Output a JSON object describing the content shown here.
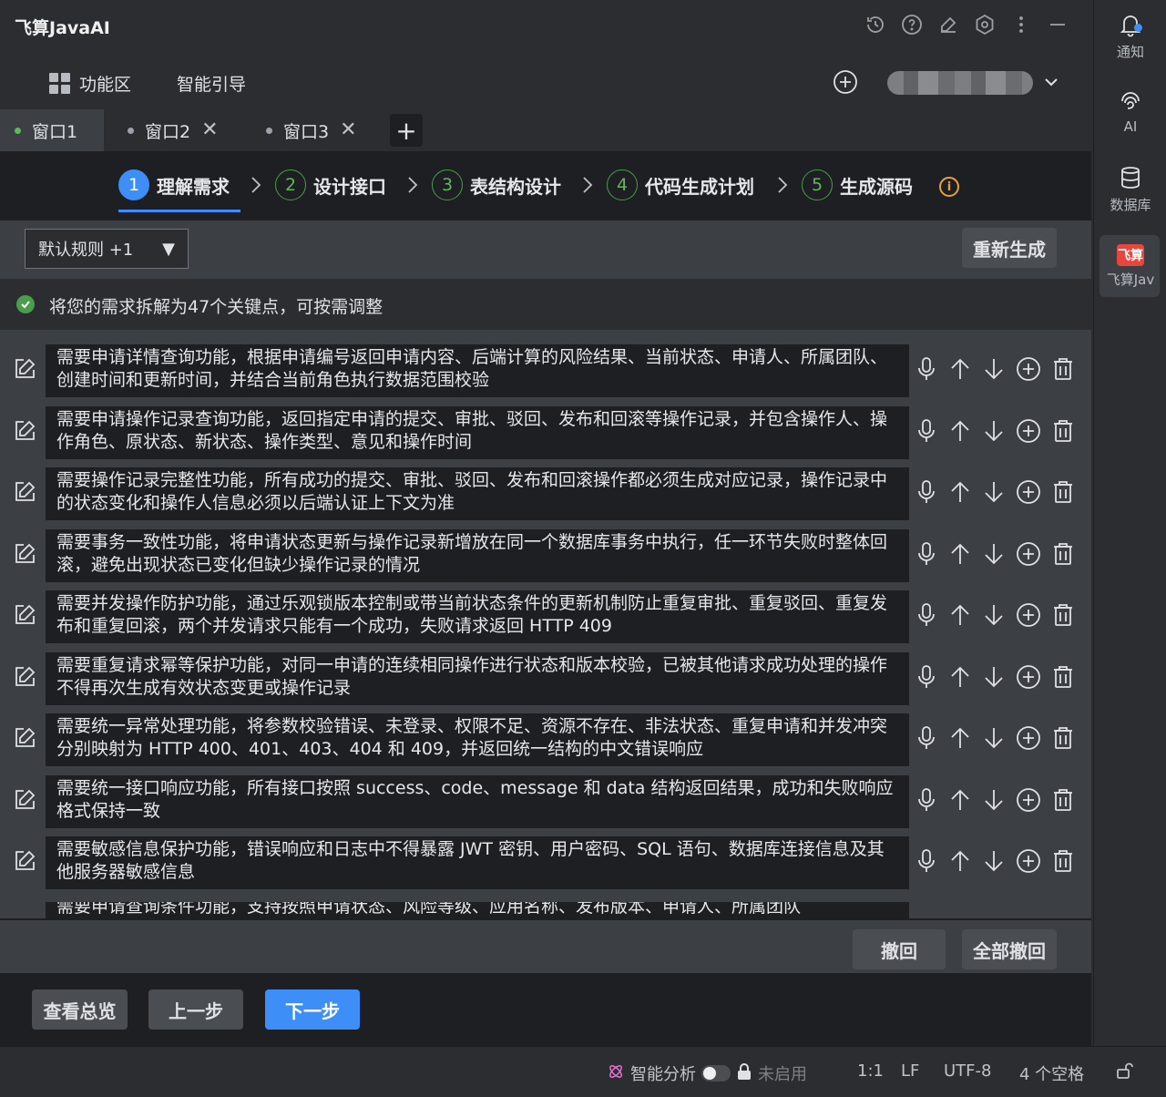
{
  "app": {
    "title": "飞算JavaAI"
  },
  "nav": {
    "feature_area": "功能区",
    "smart_guide": "智能引导"
  },
  "tabs": [
    {
      "label": "窗口1",
      "active": true
    },
    {
      "label": "窗口2",
      "close": "✕"
    },
    {
      "label": "窗口3",
      "close": "✕"
    }
  ],
  "tab_add": "+",
  "steps": [
    {
      "num": "1",
      "label": "理解需求"
    },
    {
      "num": "2",
      "label": "设计接口"
    },
    {
      "num": "3",
      "label": "表结构设计"
    },
    {
      "num": "4",
      "label": "代码生成计划"
    },
    {
      "num": "5",
      "label": "生成源码"
    }
  ],
  "rules": {
    "selected": "默认规则 +1",
    "regenerate": "重新生成"
  },
  "info": {
    "text": "将您的需求拆解为47个关键点，可按需调整"
  },
  "requirements": [
    "需要申请详情查询功能，根据申请编号返回申请内容、后端计算的风险结果、当前状态、申请人、所属团队、创建时间和更新时间，并结合当前角色执行数据范围校验",
    "需要申请操作记录查询功能，返回指定申请的提交、审批、驳回、发布和回滚等操作记录，并包含操作人、操作角色、原状态、新状态、操作类型、意见和操作时间",
    "需要操作记录完整性功能，所有成功的提交、审批、驳回、发布和回滚操作都必须生成对应记录，操作记录中的状态变化和操作人信息必须以后端认证上下文为准",
    "需要事务一致性功能，将申请状态更新与操作记录新增放在同一个数据库事务中执行，任一环节失败时整体回滚，避免出现状态已变化但缺少操作记录的情况",
    "需要并发操作防护功能，通过乐观锁版本控制或带当前状态条件的更新机制防止重复审批、重复驳回、重复发布和重复回滚，两个并发请求只能有一个成功，失败请求返回 HTTP 409",
    "需要重复请求幂等保护功能，对同一申请的连续相同操作进行状态和版本校验，已被其他请求成功处理的操作不得再次生成有效状态变更或操作记录",
    "需要统一异常处理功能，将参数校验错误、未登录、权限不足、资源不存在、非法状态、重复申请和并发冲突分别映射为 HTTP 400、401、403、404 和 409，并返回统一结构的中文错误响应",
    "需要统一接口响应功能，所有接口按照 success、code、message 和 data 结构返回结果，成功和失败响应格式保持一致",
    "需要敏感信息保护功能，错误响应和日志中不得暴露 JWT 密钥、用户密码、SQL 语句、数据库连接信息及其他服务器敏感信息"
  ],
  "partial_row": "需要申请查询条件功能，支持按照申请状态、风险等级、应用名称、发布版本、申请人、所属团队",
  "undo": {
    "undo": "撤回",
    "undo_all": "全部撤回"
  },
  "bottom": {
    "overview": "查看总览",
    "prev": "上一步",
    "next": "下一步"
  },
  "rail": {
    "notify": "通知",
    "ai": "AI",
    "db": "数据库",
    "feisuan": "飞算Jav",
    "feisuan_logo": "飞算"
  },
  "status": {
    "smart_analysis": "智能分析",
    "disabled": "未启用",
    "position": "1:1",
    "line_ending": "LF",
    "encoding": "UTF-8",
    "indent": "4 个空格"
  },
  "colors": {
    "accent": "#3d8ef7",
    "success": "#4a9d4a",
    "warning": "#e6a23c",
    "brand": "#e8453c"
  }
}
